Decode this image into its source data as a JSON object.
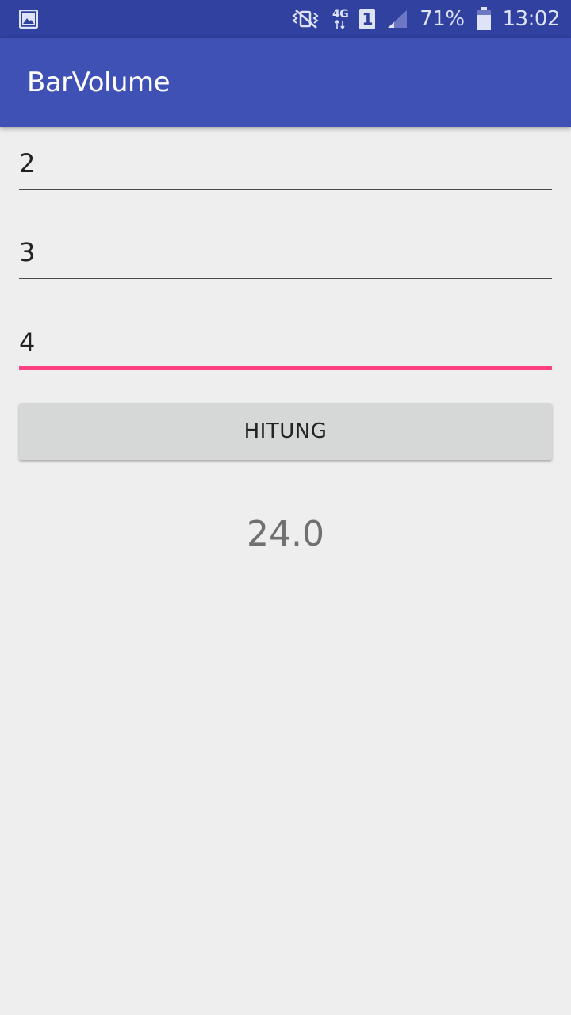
{
  "status_bar": {
    "icons": [
      "image-notification-icon",
      "vibrate-mode-icon",
      "network-4g-icon",
      "sim-1-icon",
      "cell-signal-icon",
      "battery-icon"
    ],
    "network_type": "4G",
    "sim_slot": "1",
    "battery": "71%",
    "time": "13:02",
    "colors": {
      "background": "#3041a0",
      "icon": "#dfe3f7"
    }
  },
  "app_bar": {
    "title": "BarVolume",
    "color": "#3f51b5"
  },
  "form": {
    "field1_value": "2",
    "field2_value": "3",
    "field3_value": "4",
    "focused_underline_color": "#ff4081"
  },
  "button": {
    "label": "HITUNG"
  },
  "result": {
    "value": "24.0"
  }
}
